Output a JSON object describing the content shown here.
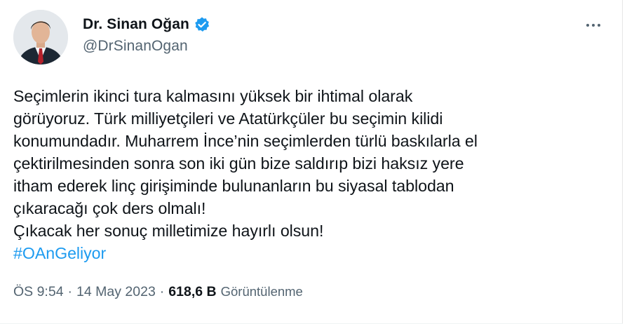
{
  "author": {
    "display_name": "Dr. Sinan Oğan",
    "handle": "@DrSinanOgan",
    "verified": true
  },
  "tweet": {
    "lines": [
      "Seçimlerin ikinci tura kalmasını yüksek bir ihtimal olarak",
      "görüyoruz. Türk milliyetçileri ve Atatürkçüler bu seçimin kilidi",
      "konumundadır. Muharrem İnce’nin seçimlerden türlü baskılarla el",
      "çektirilmesinden sonra son iki gün bize saldırıp bizi haksız yere",
      "itham ederek linç girişiminde bulunanların bu siyasal tablodan",
      "çıkaracağı çok ders olmalı!",
      "Çıkacak her sonuç milletimize hayırlı olsun!"
    ],
    "hashtag": "#OAnGeliyor"
  },
  "meta": {
    "time": "ÖS 9:54",
    "separator": "·",
    "date": "14 May 2023",
    "views_count": "618,6 B",
    "views_label": "Görüntülenme"
  },
  "icons": {
    "verified": "verified-badge-icon",
    "more": "more-options-icon"
  },
  "colors": {
    "accent": "#1d9bf0",
    "text_primary": "#0f1419",
    "text_secondary": "#536471"
  }
}
